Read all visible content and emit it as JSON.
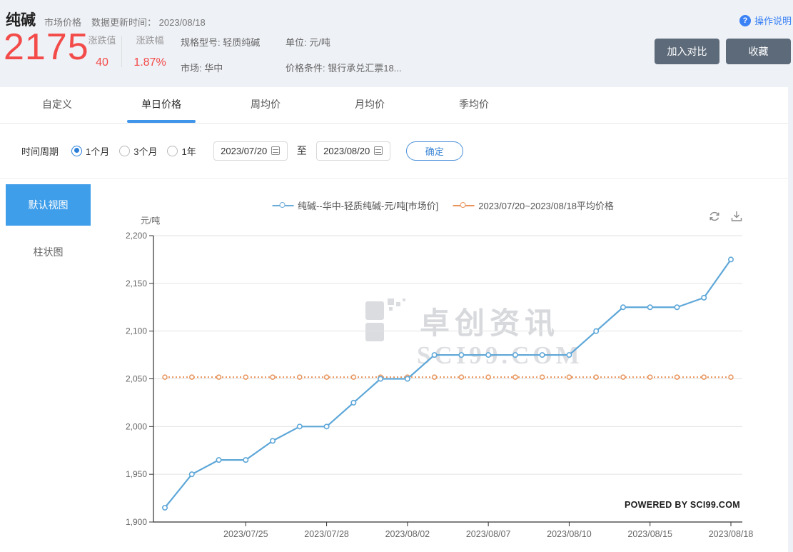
{
  "header": {
    "title": "纯碱",
    "subtitle": "市场价格",
    "update_label": "数据更新时间：",
    "update_date": "2023/08/18",
    "price": "2175",
    "change_label": "涨跌值",
    "change_value": "40",
    "pct_label": "涨跌幅",
    "pct_value": "1.87%",
    "spec_line": "规格型号: 轻质纯碱",
    "market_line": "市场: 华中",
    "unit_line": "单位: 元/吨",
    "condition_line": "价格条件: 银行承兑汇票18...",
    "help_icon": "?",
    "help_label": "操作说明",
    "compare_button": "加入对比",
    "favorite_button": "收藏"
  },
  "tabs": [
    {
      "label": "自定义",
      "active": false
    },
    {
      "label": "单日价格",
      "active": true
    },
    {
      "label": "周均价",
      "active": false
    },
    {
      "label": "月均价",
      "active": false
    },
    {
      "label": "季均价",
      "active": false
    }
  ],
  "filter": {
    "period_label": "时间周期",
    "options": [
      {
        "label": "1个月",
        "selected": true
      },
      {
        "label": "3个月",
        "selected": false
      },
      {
        "label": "1年",
        "selected": false
      }
    ],
    "start_date": "2023/07/20",
    "to_label": "至",
    "end_date": "2023/08/20",
    "confirm_button": "确定"
  },
  "sidebar": {
    "items": [
      {
        "label": "默认视图",
        "active": true
      },
      {
        "label": "柱状图",
        "active": false
      }
    ]
  },
  "chart": {
    "watermark_cn": "卓创资讯",
    "watermark_en": "SCI99.COM",
    "powered_by": "POWERED BY SCI99.COM",
    "colors": {
      "line": "#5ea7d8",
      "average": "#e8935a",
      "grid": "#e2e2e2",
      "axis": "#333333",
      "tick_text": "#666666"
    }
  },
  "chart_data": {
    "type": "line",
    "y_axis_title": "元/吨",
    "x": [
      "2023/07/20",
      "2023/07/21",
      "2023/07/24",
      "2023/07/25",
      "2023/07/26",
      "2023/07/27",
      "2023/07/28",
      "2023/07/31",
      "2023/08/01",
      "2023/08/02",
      "2023/08/03",
      "2023/08/04",
      "2023/08/07",
      "2023/08/08",
      "2023/08/09",
      "2023/08/10",
      "2023/08/11",
      "2023/08/14",
      "2023/08/15",
      "2023/08/16",
      "2023/08/17",
      "2023/08/18"
    ],
    "series": [
      {
        "name": "纯碱--华中-轻质纯碱-元/吨[市场价]",
        "color": "#5ea7d8",
        "values": [
          1915,
          1950,
          1965,
          1965,
          1985,
          2000,
          2000,
          2025,
          2050,
          2050,
          2075,
          2075,
          2075,
          2075,
          2075,
          2075,
          2100,
          2125,
          2125,
          2125,
          2135,
          2175
        ]
      },
      {
        "name": "2023/07/20~2023/08/18平均价格",
        "color": "#e8935a",
        "type": "constant",
        "value": 2051.8
      }
    ],
    "ylim": [
      1900,
      2200
    ],
    "y_ticks": [
      {
        "value": 2200,
        "label": "2,200"
      },
      {
        "value": 2150,
        "label": "2,150"
      },
      {
        "value": 2100,
        "label": "2,100"
      },
      {
        "value": 2050,
        "label": "2,050"
      },
      {
        "value": 2000,
        "label": "2,000"
      },
      {
        "value": 1950,
        "label": "1,950"
      },
      {
        "value": 1900,
        "label": "1,900"
      }
    ],
    "x_ticks": [
      {
        "index": 3,
        "label": "2023/07/25"
      },
      {
        "index": 6,
        "label": "2023/07/28"
      },
      {
        "index": 9,
        "label": "2023/08/02"
      },
      {
        "index": 12,
        "label": "2023/08/07"
      },
      {
        "index": 15,
        "label": "2023/08/10"
      },
      {
        "index": 18,
        "label": "2023/08/15"
      },
      {
        "index": 21,
        "label": "2023/08/18"
      }
    ],
    "grid": true,
    "legend_position": "top"
  }
}
